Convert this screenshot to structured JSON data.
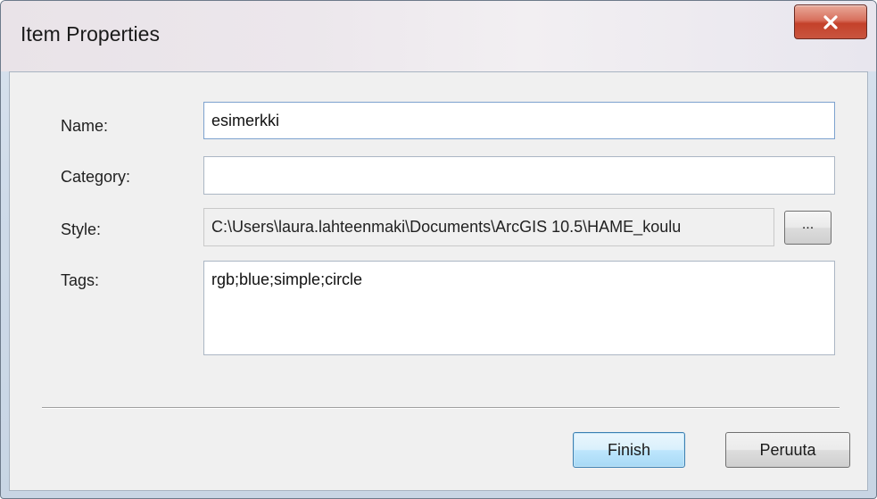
{
  "window": {
    "title": "Item Properties",
    "close_icon": "close-x-icon"
  },
  "form": {
    "name": {
      "label": "Name:",
      "value": "esimerkki"
    },
    "category": {
      "label": "Category:",
      "value": ""
    },
    "style": {
      "label": "Style:",
      "value": "C:\\Users\\laura.lahteenmaki\\Documents\\ArcGIS 10.5\\HAME_koulu",
      "browse_label": "..."
    },
    "tags": {
      "label": "Tags:",
      "value": "rgb;blue;simple;circle"
    }
  },
  "buttons": {
    "finish_label": "Finish",
    "cancel_label": "Peruuta"
  },
  "colors": {
    "close_button": "#c4412a",
    "default_button_border": "#3c7fb1"
  }
}
